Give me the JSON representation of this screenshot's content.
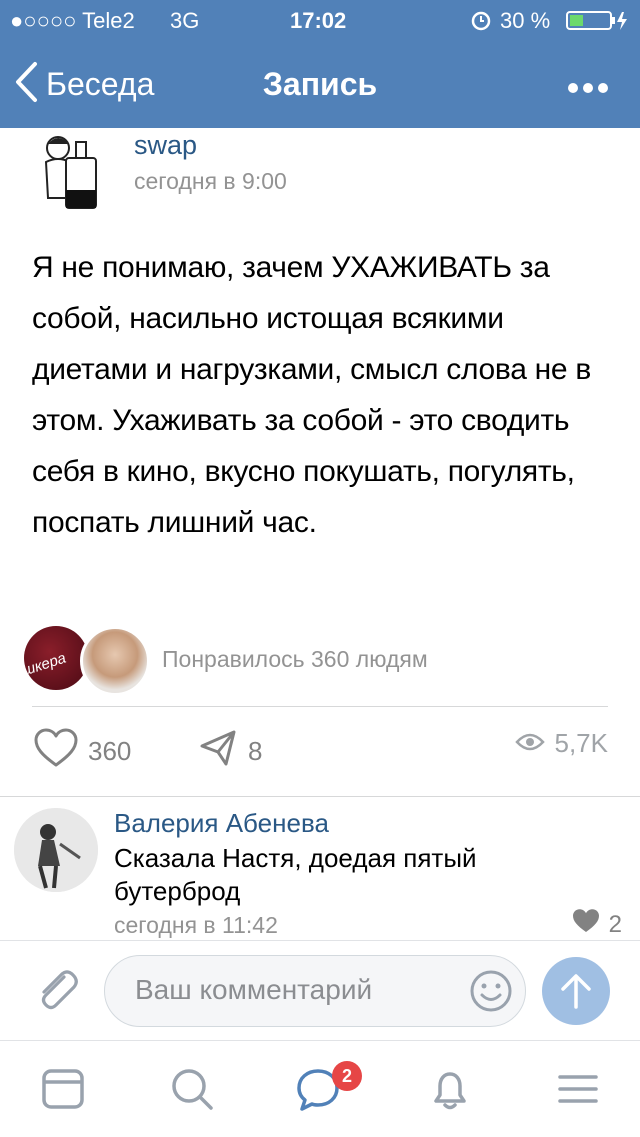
{
  "status_bar": {
    "carrier": "●○○○○ Tele2",
    "network": "3G",
    "time": "17:02",
    "battery": "30 %"
  },
  "nav": {
    "back_label": "Беседа",
    "title": "Запись"
  },
  "post": {
    "author": "swap",
    "date": "сегодня в 9:00",
    "text": "Я не понимаю, зачем УХАЖИВАТЬ за собой, насильно истощая всякими диетами и нагрузками, смысл слова не в этом. Ухаживать за собой - это сводить себя в кино, вкусно покушать, погулять, поспать лишний час.",
    "liked_by_text": "Понравилось 360 людям",
    "like_avatar_label": "шкера",
    "likes": "360",
    "reposts": "8",
    "views": "5,7K"
  },
  "comment": {
    "author": "Валерия Абенева",
    "text": "Сказала Настя, доедая пятый бутерброд",
    "date": "сегодня в 11:42",
    "likes": "2"
  },
  "composer": {
    "placeholder": "Ваш комментарий"
  },
  "tabbar": {
    "messages_badge": "2"
  },
  "colors": {
    "header": "#5181b8",
    "link": "#2a5885",
    "secondary_text": "#939393",
    "icon": "#828282",
    "tab_icon": "#99a2ad",
    "send_button": "#a0bfe3",
    "badge": "#e64646"
  },
  "icons": [
    "back-chevron-icon",
    "more-icon",
    "heart-icon",
    "share-icon",
    "eye-icon",
    "paperclip-icon",
    "emoji-icon",
    "send-arrow-icon",
    "feed-icon",
    "search-icon",
    "messages-icon",
    "notifications-icon",
    "menu-icon"
  ]
}
